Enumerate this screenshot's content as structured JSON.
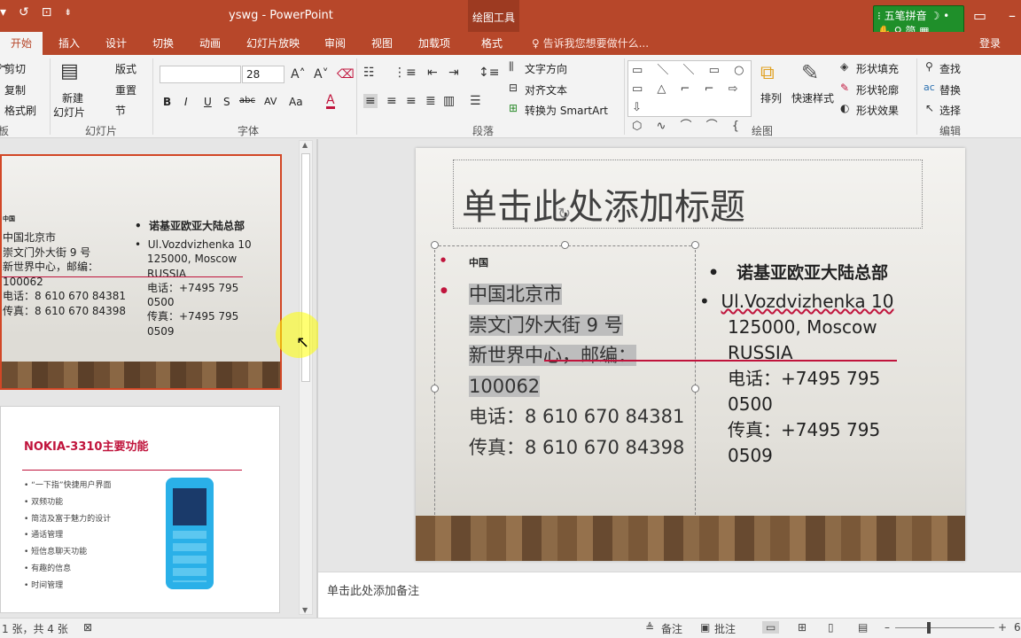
{
  "window": {
    "doc_title": "yswg - PowerPoint",
    "context_tool": "绘图工具",
    "ime_name": "五笔拼音",
    "ime_mode": "简",
    "ime_moon": "☽",
    "ime_dot": "•"
  },
  "tabs": [
    {
      "label": "开始",
      "active": true
    },
    {
      "label": "插入"
    },
    {
      "label": "设计"
    },
    {
      "label": "切换"
    },
    {
      "label": "动画"
    },
    {
      "label": "幻灯片放映"
    },
    {
      "label": "审阅"
    },
    {
      "label": "视图"
    },
    {
      "label": "加载项"
    },
    {
      "label": "格式"
    }
  ],
  "tell_me": "告诉我您想要做什么...",
  "login": "登录",
  "ribbon": {
    "clipboard": {
      "cut": "剪切",
      "copy": "复制",
      "format_painter": "格式刷",
      "label": "板"
    },
    "slides": {
      "new_slide": "新建",
      "new_slide2": "幻灯片",
      "layout": "版式",
      "reset": "重置",
      "section": "节",
      "label": "幻灯片"
    },
    "font": {
      "size": "28",
      "label": "字体",
      "bold": "B",
      "italic": "I",
      "underline": "U",
      "strike": "S",
      "spacing": "abc",
      "char_spacing": "AV",
      "case": "Aa",
      "color_a": "A"
    },
    "paragraph": {
      "text_direction": "文字方向",
      "align_text": "对齐文本",
      "smartart": "转换为 SmartArt",
      "label": "段落"
    },
    "drawing": {
      "arrange": "排列",
      "quick_styles": "快速样式",
      "shape_fill": "形状填充",
      "shape_outline": "形状轮廓",
      "shape_effects": "形状效果",
      "label": "绘图"
    },
    "editing": {
      "find": "查找",
      "replace": "替换",
      "select": "选择",
      "label": "编辑"
    }
  },
  "thumb1": {
    "left_heading": "中国",
    "left_lines": [
      "中国北京市",
      "崇文门外大街 9 号",
      "新世界中心，邮编：",
      "100062",
      "电话：8 610 670 84381",
      "传真：8 610 670 84398"
    ],
    "right_heading": "诺基亚欧亚大陆总部",
    "right_lines": [
      "Ul.Vozdvizhenka 10",
      "125000, Moscow",
      "RUSSIA",
      "电话：+7495 795",
      "0500",
      "传真：+7495 795",
      "0509"
    ]
  },
  "thumb2": {
    "title": "NOKIA-3310主要功能",
    "bullets": [
      "“一下指”快捷用户界面",
      "双频功能",
      "简洁及富于魅力的设计",
      "通话管理",
      "短信息聊天功能",
      "有趣的信息",
      "时间管理"
    ]
  },
  "slide": {
    "title_placeholder": "单击此处添加标题",
    "left_heading": "中国",
    "left_selected": [
      "中国北京市",
      "崇文门外大街 9 号",
      "新世界中心，邮编：",
      "100062"
    ],
    "left_rest": [
      "电话：8 610 670 84381",
      "传真：8 610 670 84398"
    ],
    "right_heading": "诺基亚欧亚大陆总部",
    "right_lines": [
      "Ul.Vozdvizhenka 10",
      "125000, Moscow",
      "RUSSIA",
      "电话：+7495 795",
      "0500",
      "传真：+7495 795",
      "0509"
    ]
  },
  "notes_placeholder": "单击此处添加备注",
  "status": {
    "slide_info": "1 张，共 4 张",
    "notes": "备注",
    "comments": "批注",
    "zoom_tail": "6"
  },
  "colors": {
    "brand": "#b7472a",
    "accent_red": "#c0143c",
    "selection": "#bdbdbd"
  }
}
